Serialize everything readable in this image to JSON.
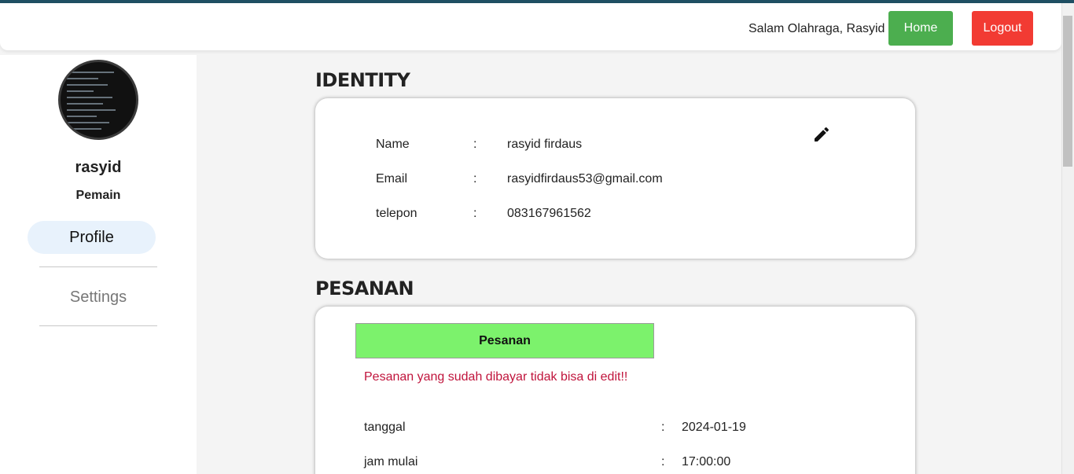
{
  "header": {
    "greeting": "Salam Olahraga, Rasyid",
    "home_label": "Home",
    "logout_label": "Logout",
    "home_color": "#4cae4f",
    "logout_color": "#f23b33"
  },
  "sidebar": {
    "username": "rasyid",
    "role": "Pemain",
    "items": [
      {
        "label": "Profile",
        "active": true
      },
      {
        "label": "Settings",
        "active": false
      }
    ]
  },
  "identity": {
    "title": "IDENTITY",
    "edit_icon": "pencil-icon",
    "rows": [
      {
        "label": "Name",
        "colon": ":",
        "value": "rasyid firdaus"
      },
      {
        "label": "Email",
        "colon": ":",
        "value": "rasyidfirdaus53@gmail.com"
      },
      {
        "label": "telepon",
        "colon": ":",
        "value": "083167961562"
      }
    ]
  },
  "pesanan": {
    "title": "PESANAN",
    "button_label": "Pesanan",
    "warning": "Pesanan yang sudah dibayar tidak bisa di edit!!",
    "rows": [
      {
        "label": "tanggal",
        "colon": ":",
        "value": "2024-01-19"
      },
      {
        "label": "jam mulai",
        "colon": ":",
        "value": "17:00:00"
      }
    ]
  }
}
